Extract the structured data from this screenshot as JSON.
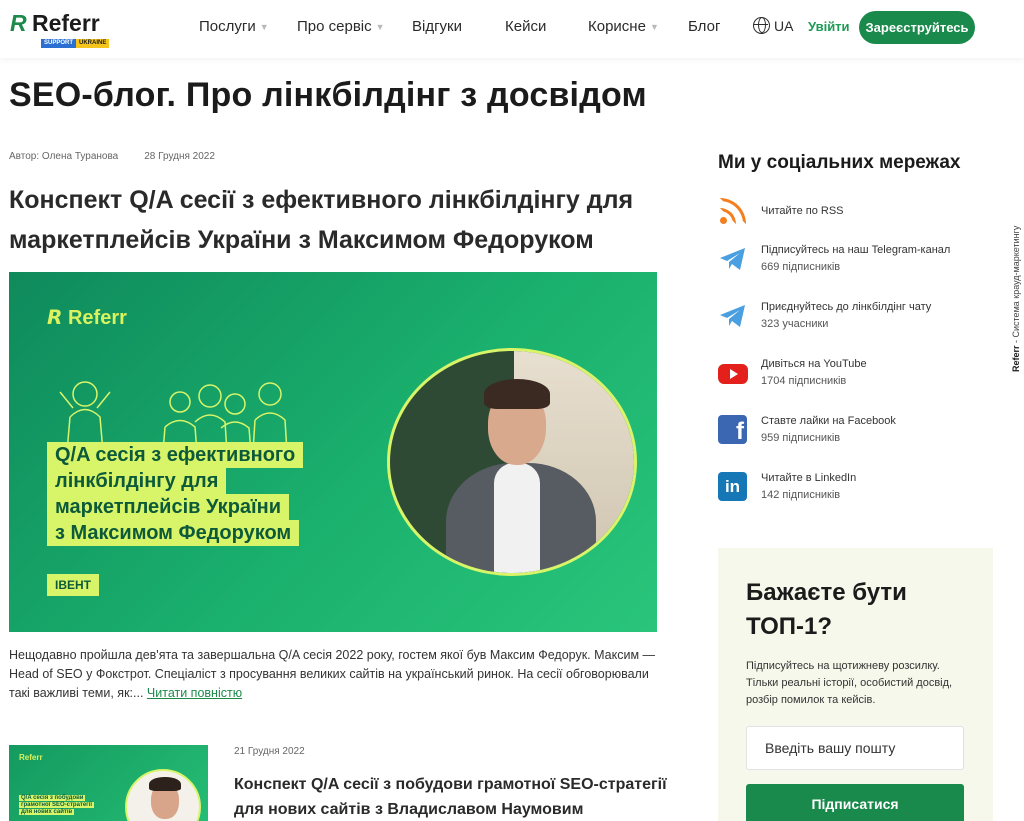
{
  "header": {
    "logo_mark": "R",
    "logo_text": "Referr",
    "logo_badge_a": "SUPPORT",
    "logo_badge_b": "UKRAINE",
    "nav": [
      {
        "label": "Послуги",
        "dropdown": true
      },
      {
        "label": "Про сервіс",
        "dropdown": true
      },
      {
        "label": "Відгуки",
        "dropdown": false
      },
      {
        "label": "Кейси",
        "dropdown": false
      },
      {
        "label": "Корисне",
        "dropdown": true
      },
      {
        "label": "Блог",
        "dropdown": false
      }
    ],
    "language": "UA",
    "login": "Увійти",
    "register": "Зареєструйтесь",
    "accent": "#1a8a4c"
  },
  "page_title": "SEO-блог. Про лінкбілдінг з досвідом",
  "featured": {
    "author": "Автор: Олена Туранова",
    "date": "28 Грудня 2022",
    "title": "Конспект Q/A сесії з ефективного лінкбілдінгу для маркетплейсів України з Максимом Федоруком",
    "image": {
      "logo": "Referr",
      "lines": [
        "Q/A сесія з ефективного",
        "лінкбілдінгу для",
        "маркетплейсів України",
        "з Максимом Федоруком"
      ],
      "badge": "ІВЕНТ"
    },
    "excerpt": "Нещодавно пройшла дев'ята та завершальна Q/A сесія 2022 року, гостем якої був Максим Федорук. Максим — Head of SEO у Фокстрот. Спеціаліст з просування великих сайтів на український ринок. На сесії обговорювали такі важливі теми, як:...",
    "read_more": "Читати повністю"
  },
  "second": {
    "date": "21 Грудня 2022",
    "title": "Конспект Q/A сесії з побудови грамотної SEO-стратегії для нових сайтів з Владиславом Наумовим",
    "thumb_logo": "Referr",
    "thumb_lines": [
      "Q/A сесія з побудови",
      "грамотної SEO-стратегії",
      "для нових сайтів"
    ]
  },
  "sidebar": {
    "social_heading": "Ми у соціальних мережах",
    "items": [
      {
        "icon": "rss-icon",
        "label": "Читайте по RSS",
        "sub": ""
      },
      {
        "icon": "telegram-icon",
        "label": "Підписуйтесь на наш Telegram-канал",
        "sub": "669 підписників"
      },
      {
        "icon": "telegram-icon",
        "label": "Приєднуйтесь до лінкбілдінг чату",
        "sub": "323 учасники"
      },
      {
        "icon": "youtube-icon",
        "label": "Дивіться на YouTube",
        "sub": "1704 підписників"
      },
      {
        "icon": "facebook-icon",
        "label": "Ставте лайки на Facebook",
        "sub": "959 підписників"
      },
      {
        "icon": "linkedin-icon",
        "label": "Читайте в LinkedIn",
        "sub": "142 підписників"
      }
    ],
    "subscribe": {
      "title": "Бажаєте бути ТОП-1?",
      "description": "Підписуйтесь на щотижневу розсилку. Тільки реальні історії, особистий досвід, розбір помилок та кейсів.",
      "placeholder": "Введіть вашу пошту",
      "button": "Підписатися"
    }
  },
  "vertical_brand": "Referr",
  "vertical_text": " - Система крауд-маркетингу"
}
